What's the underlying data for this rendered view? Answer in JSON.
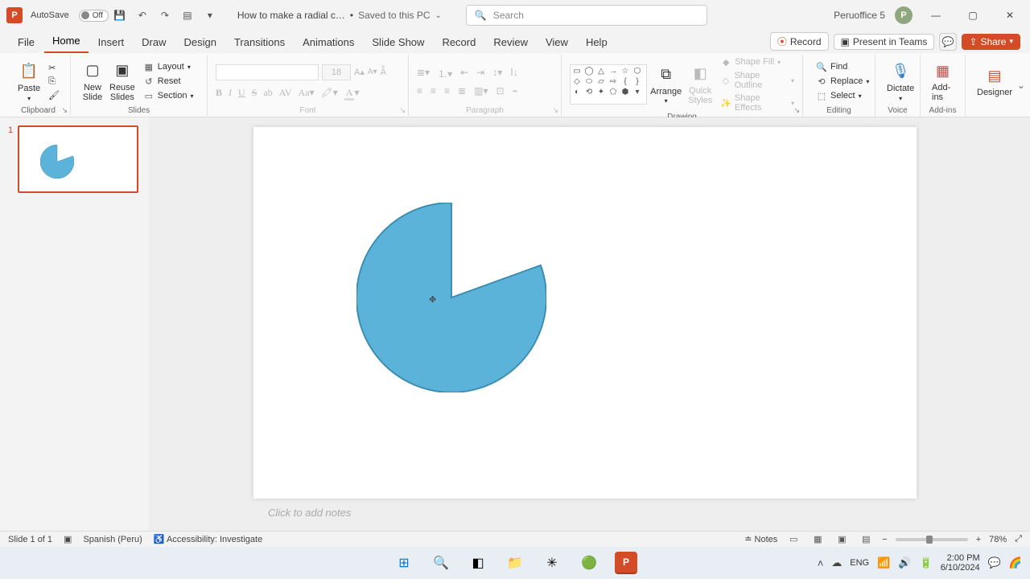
{
  "titlebar": {
    "app_initial": "P",
    "autosave_label": "AutoSave",
    "autosave_state": "Off",
    "doc_title": "How to make a radial c…",
    "saved_state": "Saved to this PC",
    "search_placeholder": "Search",
    "user_name": "Peruoffice 5",
    "user_initial": "P"
  },
  "tabs": {
    "file": "File",
    "home": "Home",
    "insert": "Insert",
    "draw": "Draw",
    "design": "Design",
    "transitions": "Transitions",
    "animations": "Animations",
    "slideshow": "Slide Show",
    "record": "Record",
    "review": "Review",
    "view": "View",
    "help": "Help",
    "record_btn": "Record",
    "present_teams": "Present in Teams",
    "share": "Share"
  },
  "ribbon": {
    "clipboard": {
      "paste": "Paste",
      "label": "Clipboard"
    },
    "slides": {
      "new_slide": "New\nSlide",
      "reuse": "Reuse\nSlides",
      "layout": "Layout",
      "reset": "Reset",
      "section": "Section",
      "label": "Slides"
    },
    "font": {
      "size": "18",
      "label": "Font"
    },
    "paragraph": {
      "label": "Paragraph"
    },
    "drawing": {
      "arrange": "Arrange",
      "quick": "Quick\nStyles",
      "fill": "Shape Fill",
      "outline": "Shape Outline",
      "effects": "Shape Effects",
      "label": "Drawing"
    },
    "editing": {
      "find": "Find",
      "replace": "Replace",
      "select": "Select",
      "label": "Editing"
    },
    "voice": {
      "dictate": "Dictate",
      "label": "Voice"
    },
    "addins": {
      "addins": "Add-ins",
      "label": "Add-ins"
    },
    "designer": {
      "designer": "Designer"
    }
  },
  "thumbs": {
    "num1": "1"
  },
  "notes": {
    "placeholder": "Click to add notes"
  },
  "status": {
    "slide": "Slide 1 of 1",
    "lang": "Spanish (Peru)",
    "accessibility": "Accessibility: Investigate",
    "notes_btn": "Notes",
    "zoom_pct": "78%"
  },
  "taskbar": {
    "lang": "ENG",
    "time": "2:00 PM",
    "date": "6/10/2024"
  },
  "chart_data": {
    "type": "pie",
    "title": "",
    "shape": "partial-pie",
    "start_angle_deg": 270,
    "sweep_angle_deg": 290,
    "fill_color": "#5bb3d9",
    "stroke_color": "#3a8bb0",
    "note": "A single blue pie-wedge shape on the slide (PowerPoint Pie autoshape), spanning roughly 290° leaving a notch on the upper-right; no data labels, legend, or axes."
  }
}
